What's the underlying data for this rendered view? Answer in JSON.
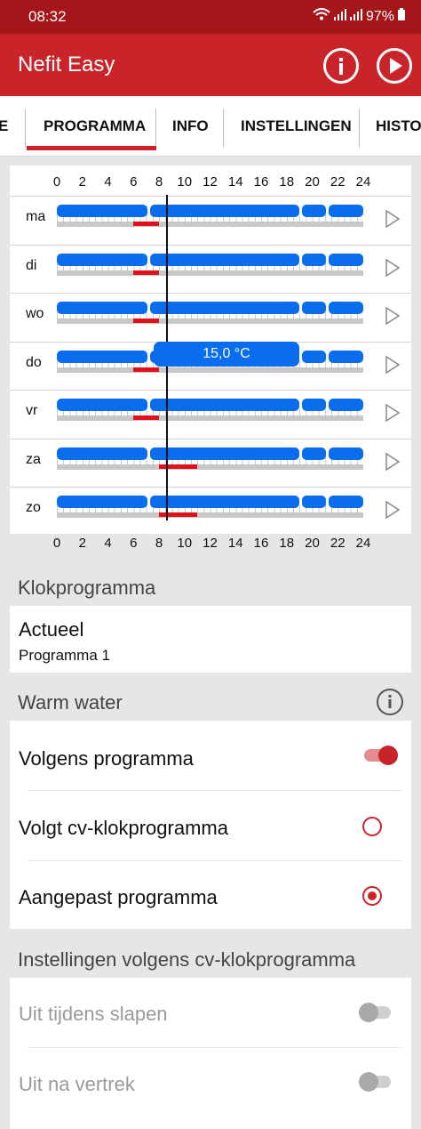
{
  "status": {
    "time": "08:32",
    "battery": "97%"
  },
  "app": {
    "title": "Nefit Easy",
    "info_icon": "info-circle-icon",
    "play_icon": "play-circle-icon"
  },
  "tabs": [
    {
      "label": "E",
      "active": false
    },
    {
      "label": "PROGRAMMA",
      "active": true
    },
    {
      "label": "INFO",
      "active": false
    },
    {
      "label": "INSTELLINGEN",
      "active": false
    },
    {
      "label": "HISTO",
      "active": false
    }
  ],
  "schedule": {
    "hour_labels": [
      "0",
      "2",
      "4",
      "6",
      "8",
      "10",
      "12",
      "14",
      "16",
      "18",
      "20",
      "22",
      "24"
    ],
    "current_time_hours": 8.55,
    "days": [
      {
        "label": "ma",
        "red": [
          6,
          8
        ]
      },
      {
        "label": "di",
        "red": [
          6,
          8
        ]
      },
      {
        "label": "wo",
        "red": [
          6,
          8
        ]
      },
      {
        "label": "do",
        "red": [
          6,
          8
        ]
      },
      {
        "label": "vr",
        "red": [
          6,
          8
        ]
      },
      {
        "label": "za",
        "red": [
          8,
          11
        ]
      },
      {
        "label": "zo",
        "red": [
          8,
          11
        ]
      }
    ],
    "temp_bubble": "15,0 °C",
    "colors": {
      "blue": "#0a6ded",
      "red": "#e0101c"
    }
  },
  "klokprogramma": {
    "header": "Klokprogramma",
    "title": "Actueel",
    "subtitle": "Programma 1"
  },
  "warm_water": {
    "header": "Warm water",
    "options": [
      {
        "label": "Volgens programma",
        "control": "toggle",
        "on": true
      },
      {
        "label": "Volgt cv-klokprogramma",
        "control": "radio",
        "selected": false
      },
      {
        "label": "Aangepast programma",
        "control": "radio",
        "selected": true
      }
    ]
  },
  "instellingen": {
    "header": "Instellingen volgens cv-klokprogramma",
    "options": [
      {
        "label": "Uit tijdens slapen",
        "on": false
      },
      {
        "label": "Uit na vertrek",
        "on": false
      }
    ]
  }
}
